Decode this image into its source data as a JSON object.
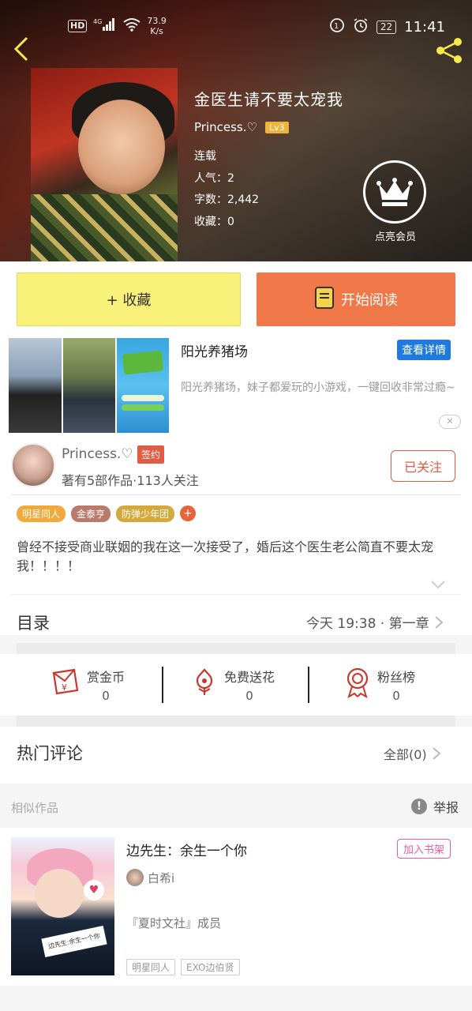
{
  "status_bar": {
    "hd": "HD",
    "signal": "4G",
    "speed_value": "73.9",
    "speed_unit": "K/s",
    "battery": "22",
    "time": "11:41"
  },
  "book": {
    "title": "金医生请不要太宠我",
    "author": "Princess.♡",
    "level": "Lv3",
    "status": "连载",
    "popularity": "人气：2",
    "word_count": "字数：2,442",
    "favorites": "收藏：0",
    "vip_label": "点亮会员"
  },
  "actions": {
    "favorite_label": "+ 收藏",
    "read_label": "开始阅读"
  },
  "ad": {
    "title": "阳光养猪场",
    "detail_button": "查看详情",
    "description": "阳光养猪场，妹子都爱玩的小游戏，一键回收非常过瘾~",
    "close": "✕"
  },
  "author_section": {
    "name": "Princess.♡",
    "sign_badge": "签约",
    "info": "著有5部作品·113人关注",
    "follow_button": "已关注",
    "tags": [
      {
        "label": "明星同人",
        "color": "#f0a93a"
      },
      {
        "label": "金泰亨",
        "color": "#b87a6a"
      },
      {
        "label": "防弹少年团",
        "color": "#d4a83a"
      }
    ],
    "tag_more": "+",
    "summary": "曾经不接受商业联姻的我在这一次接受了，婚后这个医生老公简直不要太宠我！！！！"
  },
  "catalog": {
    "title": "目录",
    "latest": "今天 19:38 · 第一章"
  },
  "stats": [
    {
      "label": "赏金币",
      "value": "0",
      "icon": "coin-envelope-icon"
    },
    {
      "label": "免费送花",
      "value": "0",
      "icon": "flower-icon"
    },
    {
      "label": "粉丝榜",
      "value": "0",
      "icon": "medal-icon"
    }
  ],
  "comments": {
    "title": "热门评论",
    "all": "全部(0)"
  },
  "similar": {
    "title": "相似作品",
    "report": "举报",
    "items": [
      {
        "title": "边先生：余生一个你",
        "add_shelf": "加入书架",
        "author": "白希i",
        "description": "『夏时文社』成员",
        "tags": [
          "明星同人",
          "EXO边伯贤"
        ]
      }
    ]
  },
  "colors": {
    "accent_orange": "#ef7748",
    "favorite_yellow": "#f9f27a",
    "sign_red": "#e55a44",
    "ad_blue": "#1f7ae0"
  }
}
